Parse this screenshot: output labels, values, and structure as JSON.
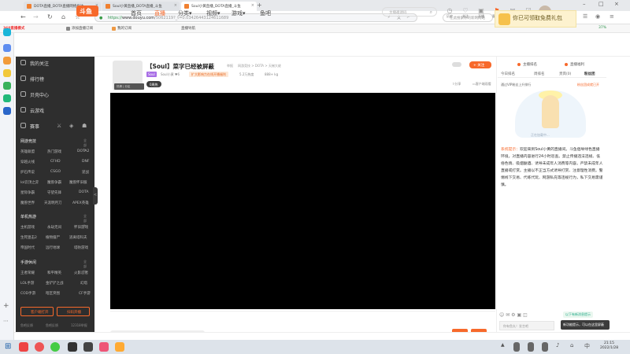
{
  "browser": {
    "tabs": [
      {
        "title": "DOTA直播_DOTA直播网络投注"
      },
      {
        "title": "Soul小黄直播_DOTA直播_斗鱼"
      },
      {
        "title": "Soul小黄直播_DOTA直播_斗鱼"
      }
    ],
    "url_scheme": "https://",
    "url_host": "www.douyu.com",
    "url_rest": "/5062119?_t=0.03426443124611689",
    "search_placeholder": "在此搜索你的新网网站",
    "promo_text": "你已可领取免费礼包",
    "bookmarks": [
      "360直播模式",
      "添加直播订阅",
      "我的订阅"
    ],
    "bookmark_right": "直播导航",
    "battery": "37%"
  },
  "site": {
    "logo_text": "斗鱼",
    "nav": [
      "首页",
      "直播",
      "分类",
      "视频",
      "游戏",
      "鱼吧"
    ],
    "search_placeholder": "主播邀请码",
    "header_icons": [
      "历史",
      "关注",
      "开播",
      "客户端",
      "消息",
      "任务"
    ]
  },
  "sidebar": {
    "main": [
      "我的关注",
      "排行榜",
      "贝壳中心",
      "云游戏",
      "赛事"
    ],
    "sections": [
      {
        "title": "网游竞技",
        "all": "全部 >",
        "items": [
          "英雄联盟",
          "热门游戏",
          "DOTA2",
          "穿越火线",
          "CFHD",
          "DNF",
          "炉石传说",
          "CSGO",
          "逆战",
          "lol云顶之弈",
          "魔兽争霸",
          "魔兽怀旧服",
          "星际争霸",
          "守望先锋",
          "DOTA",
          "魔兽世界",
          "天涯明月刀",
          "APEX英雄"
        ]
      },
      {
        "title": "单机热游",
        "all": "全部 >",
        "items": [
          "主机游戏",
          "永劫无间",
          "怀旧游戏",
          "生死狙击2",
          "植物僵尸",
          "逃离塔科夫",
          "帝国时代",
          "远行地球",
          "塔防游戏"
        ]
      },
      {
        "title": "手游休闲",
        "all": "全部 >",
        "items": [
          "王者荣耀",
          "和平精英",
          "火影忍者",
          "LOL手游",
          "金铲铲之战",
          "幻塔",
          "COD手游",
          "暗区突围",
          "CF手游"
        ]
      }
    ],
    "buttons": [
      "客户端打开",
      "扫码开播"
    ],
    "footer": [
      "鱼吧反馈",
      "鱼吧反馈",
      "12318举报"
    ],
    "collapse": "<"
  },
  "room": {
    "rank_strip": "热榜 | 分区",
    "title": "【Soul】菜字已经被屏蔽",
    "sub1": "举报",
    "sub2": "网游竞技 > DOTA > 天梯大佬",
    "badge": "Soul",
    "anchor": "Soul小黄",
    "level": "6",
    "promo": "扩大影响力在线开播福利",
    "hot": "5.2万热度",
    "fans": "888+ kg",
    "followers": "0周热",
    "follow_btn": "+ 关注",
    "actions": [
      "分享",
      "客户端观看"
    ]
  },
  "right": {
    "top_buttons": [
      "主播排名",
      "直播福利"
    ],
    "tabs": [
      "今日排名",
      "周排名",
      "贵宾(0)",
      "粉丝团"
    ],
    "notice": "通过VIP粉丝上升排行",
    "opt": "粉丝团成就已开",
    "loading": "正在加载中...",
    "sysmsg_label": "系统提示：",
    "sysmsg_text": "欢迎来到Soul小黄的直播间。斗鱼倡导绿色直播环境，对直播内容进行24小时巡查。禁止传播违法违规、低俗色情、吸烟酗酒、诱导未成年人消费等内容。严禁未成年人直播或打赏。主播以不正当方式诱导打赏、注意理性消费。警惕线下交易、代练代玩、网游私充等违规行为，私下交易需谨慎。",
    "notif1": "以下有新消息提示",
    "input_placeholder": "你有鱼丸！发言吧",
    "notif2": "新功能提示，可以在这里屏蔽"
  },
  "taskbar": {
    "time": "21:15",
    "date": "2022/1/28"
  }
}
